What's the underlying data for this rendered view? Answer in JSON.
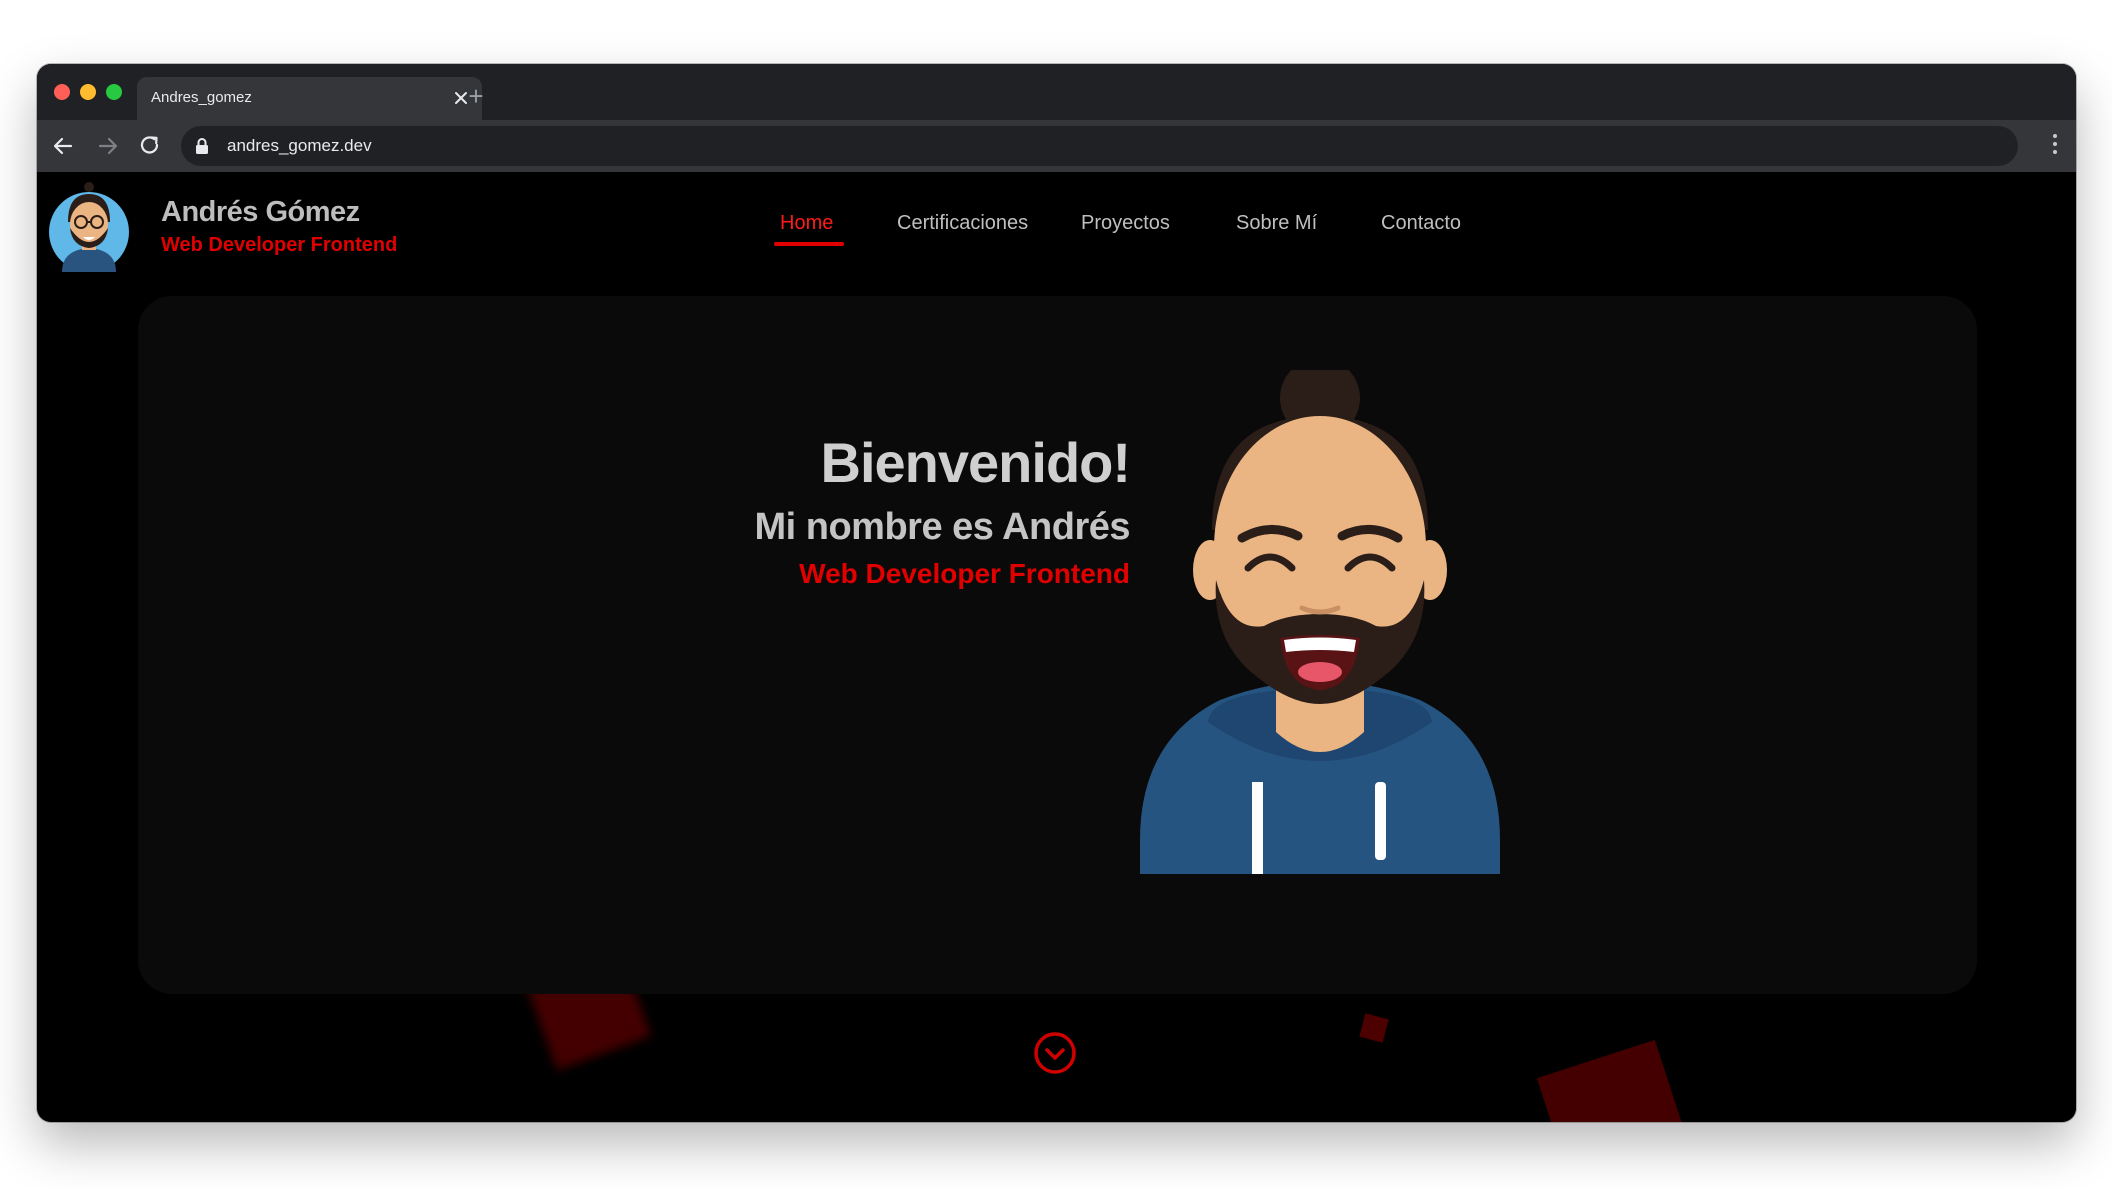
{
  "browser": {
    "tab_title": "Andres_gomez",
    "new_tab_symbol": "+",
    "url": "andres_gomez.dev"
  },
  "site": {
    "brand": {
      "name": "Andrés Gómez",
      "role": "Web Developer Frontend"
    },
    "nav": [
      {
        "label": "Home",
        "active": true
      },
      {
        "label": "Certificaciones"
      },
      {
        "label": "Proyectos"
      },
      {
        "label": "Sobre Mí"
      },
      {
        "label": "Contacto"
      }
    ],
    "hero": {
      "title": "Bienvenido!",
      "subtitle": "Mi nombre es Andrés",
      "role": "Web Developer Frontend"
    },
    "icons": {
      "scroll": "chevron-down-circle-icon",
      "avatar": "developer-avatar-illustration"
    },
    "colors": {
      "accent": "#e00000",
      "background": "#000000",
      "card": "#0a0a0a",
      "text": "#cfcfcf"
    }
  }
}
